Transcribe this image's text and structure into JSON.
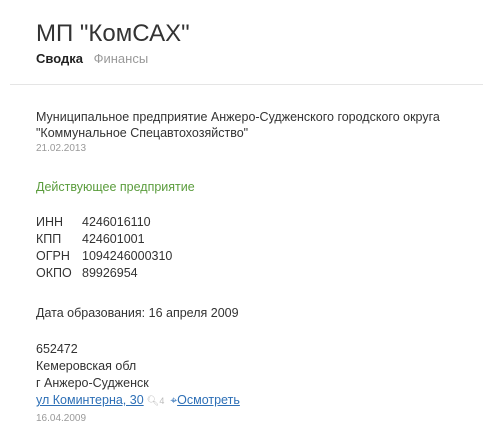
{
  "header": {
    "title": "МП \"КомСАХ\"",
    "tabs": [
      {
        "label": "Сводка"
      },
      {
        "label": "Финансы"
      }
    ]
  },
  "company": {
    "full_name_line1": "Муниципальное предприятие Анжеро-Судженского городского округа",
    "full_name_line2": "\"Коммунальное Спецавтохозяйство\"",
    "name_date": "21.02.2013",
    "status": "Действующее предприятие"
  },
  "codes": [
    {
      "label": "ИНН",
      "value": "4246016110"
    },
    {
      "label": "КПП",
      "value": "424601001"
    },
    {
      "label": "ОГРН",
      "value": "1094246000310"
    },
    {
      "label": "ОКПО",
      "value": "89926954"
    }
  ],
  "founded": "Дата образования: 16 апреля 2009",
  "address": {
    "zip": "652472",
    "region": "Кемеровская обл",
    "city": "г Анжеро-Судженск",
    "street": "ул Коминтерна, 30",
    "search_icon": "search-icon",
    "search_count": "4",
    "map_icon": "map-pin-icon",
    "view_label": "Осмотреть",
    "date": "16.04.2009"
  }
}
